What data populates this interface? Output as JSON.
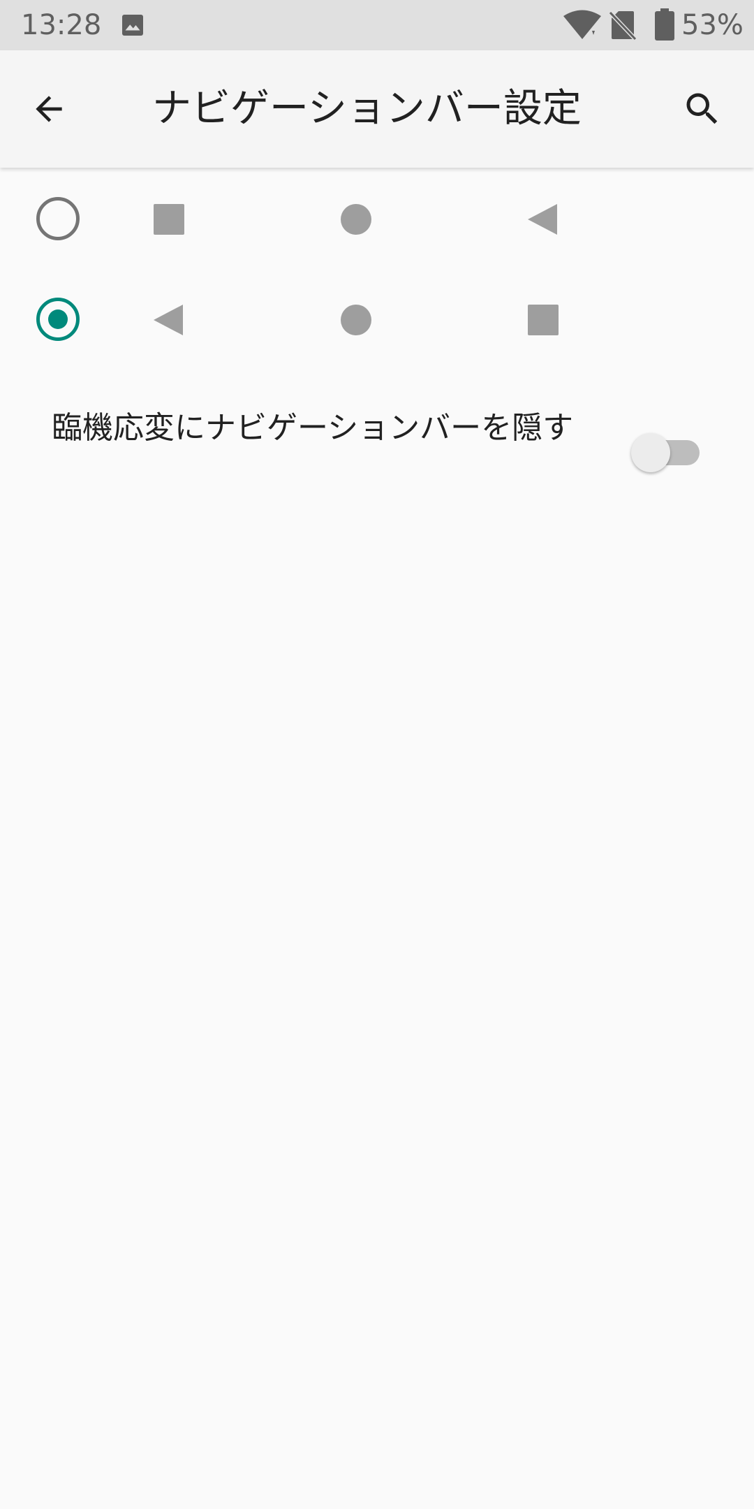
{
  "status_bar": {
    "time": "13:28",
    "battery_percent": "53%",
    "icons": [
      "gallery-icon",
      "wifi-icon",
      "no-sim-icon",
      "battery-icon"
    ]
  },
  "app_bar": {
    "title": "ナビゲーションバー設定",
    "back_icon": "arrow-back-icon",
    "search_icon": "search-icon"
  },
  "nav_layouts": [
    {
      "selected": false,
      "buttons": [
        "recents",
        "home",
        "back"
      ]
    },
    {
      "selected": true,
      "buttons": [
        "back",
        "home",
        "recents"
      ]
    }
  ],
  "auto_hide": {
    "label": "臨機応変にナビゲーションバーを隠す",
    "enabled": false
  },
  "colors": {
    "accent": "#00897b",
    "nav_icon": "#9e9e9e",
    "radio_off": "#757575",
    "background": "#fafafa",
    "status_bar": "#e0e0e0"
  }
}
